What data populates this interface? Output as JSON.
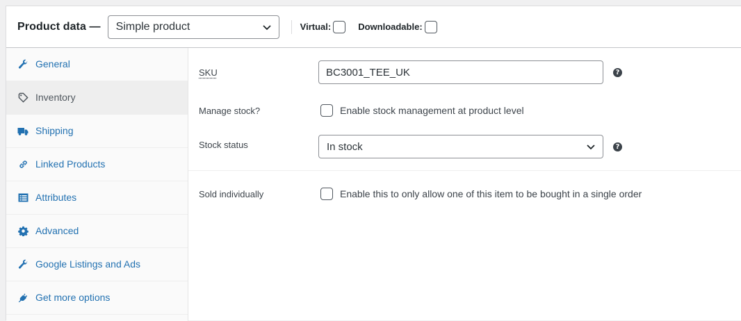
{
  "header": {
    "title": "Product data —",
    "product_type": "Simple product",
    "virtual_label": "Virtual:",
    "downloadable_label": "Downloadable:"
  },
  "tabs": [
    {
      "label": "General",
      "icon": "wrench-icon"
    },
    {
      "label": "Inventory",
      "icon": "tag-icon",
      "active": true
    },
    {
      "label": "Shipping",
      "icon": "truck-icon"
    },
    {
      "label": "Linked Products",
      "icon": "link-icon"
    },
    {
      "label": "Attributes",
      "icon": "list-icon"
    },
    {
      "label": "Advanced",
      "icon": "gear-icon"
    },
    {
      "label": "Google Listings and Ads",
      "icon": "wrench-icon"
    },
    {
      "label": "Get more options",
      "icon": "plug-icon"
    }
  ],
  "inventory": {
    "sku_label": "SKU",
    "sku_value": "BC3001_TEE_UK",
    "manage_stock_label": "Manage stock?",
    "manage_stock_text": "Enable stock management at product level",
    "stock_status_label": "Stock status",
    "stock_status_value": "In stock",
    "sold_individually_label": "Sold individually",
    "sold_individually_text": "Enable this to only allow one of this item to be bought in a single order",
    "help_glyph": "?"
  },
  "colors": {
    "link": "#2271b1",
    "active_tab_bg": "#eeeeee",
    "text": "#3c434a"
  }
}
